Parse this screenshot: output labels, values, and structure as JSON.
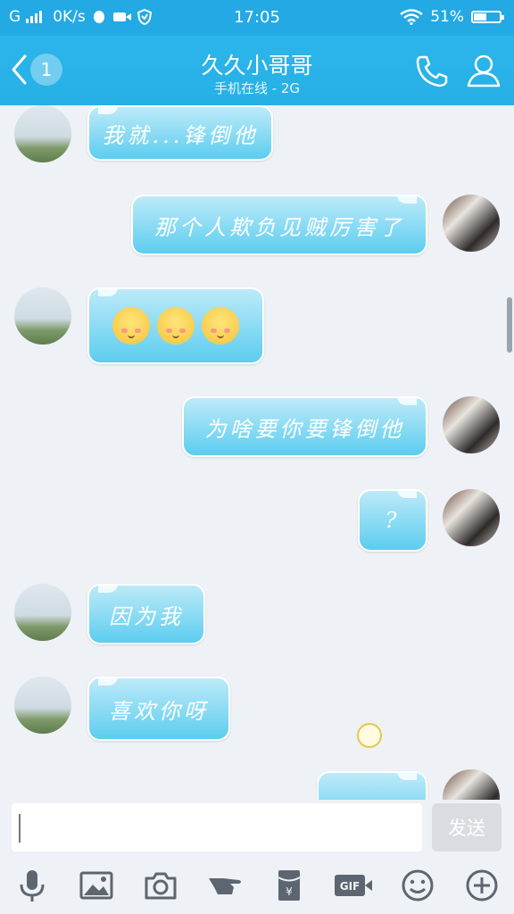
{
  "statusbar": {
    "network": "G",
    "speed": "0K/s",
    "time": "17:05",
    "battery": "51%",
    "battery_level": 0.51
  },
  "header": {
    "back_count": "1",
    "title": "久久小哥哥",
    "subtitle": "手机在线 - 2G",
    "back_icon": "chevron-left-icon",
    "call_icon": "phone-icon",
    "profile_icon": "person-icon"
  },
  "messages": [
    {
      "side": "left",
      "text": "我就...锋倒他"
    },
    {
      "side": "right",
      "text": "那个人欺负见贼厉害了"
    },
    {
      "side": "left",
      "emoji_count": 3,
      "emoji": "blushing-face-icon"
    },
    {
      "side": "right",
      "text": "为啥要你要锋倒他"
    },
    {
      "side": "right",
      "text": "?"
    },
    {
      "side": "left",
      "text": "因为我"
    },
    {
      "side": "left",
      "text": "喜欢你呀"
    },
    {
      "side": "right",
      "partial": true
    }
  ],
  "input": {
    "value": "",
    "send_label": "发送"
  },
  "toolbar": {
    "items": [
      "microphone-icon",
      "image-icon",
      "camera-icon",
      "poke-icon",
      "red-packet-icon",
      "gif-icon",
      "emoji-icon",
      "plus-icon"
    ],
    "gif_label": "GIF"
  },
  "colors": {
    "header": "#26b0e6",
    "bubble_top": "#bdeaf9",
    "bubble_bottom": "#5ccdef",
    "background": "#eef1f5"
  }
}
